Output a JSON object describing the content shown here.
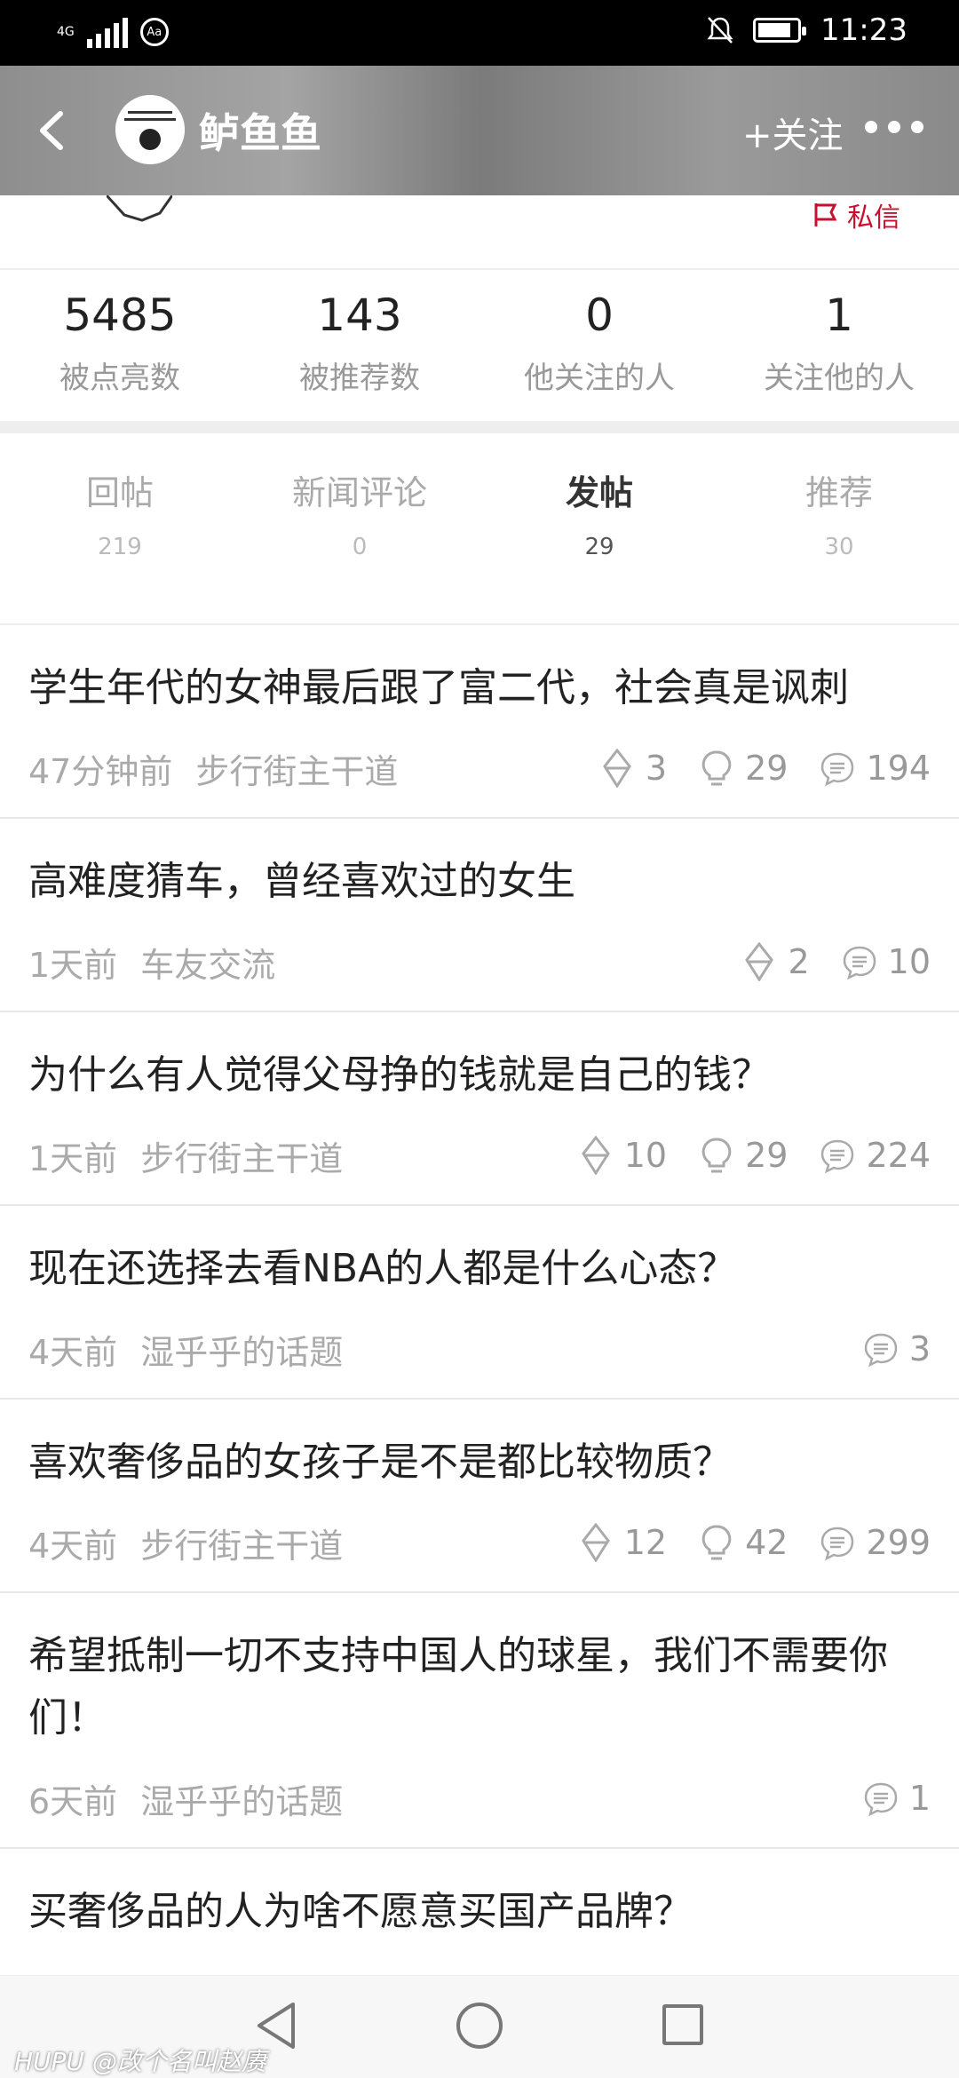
{
  "status_bar": {
    "network": "4G",
    "time": "11:23"
  },
  "header": {
    "username": "鲈鱼鱼",
    "follow_label": "+关注",
    "dm_label": "私信"
  },
  "stats": [
    {
      "value": "5485",
      "label": "被点亮数"
    },
    {
      "value": "143",
      "label": "被推荐数"
    },
    {
      "value": "0",
      "label": "他关注的人"
    },
    {
      "value": "1",
      "label": "关注他的人"
    }
  ],
  "tabs": [
    {
      "label": "回帖",
      "count": "219"
    },
    {
      "label": "新闻评论",
      "count": "0"
    },
    {
      "label": "发帖",
      "count": "29",
      "active": true
    },
    {
      "label": "推荐",
      "count": "30"
    }
  ],
  "posts": [
    {
      "title": "学生年代的女神最后跟了富二代，社会真是讽刺",
      "time": "47分钟前",
      "board": "步行街主干道",
      "lights": "3",
      "recommends": "29",
      "replies": "194"
    },
    {
      "title": "高难度猜车，曾经喜欢过的女生",
      "time": "1天前",
      "board": "车友交流",
      "lights": "2",
      "replies": "10"
    },
    {
      "title": "为什么有人觉得父母挣的钱就是自己的钱？",
      "time": "1天前",
      "board": "步行街主干道",
      "lights": "10",
      "recommends": "29",
      "replies": "224"
    },
    {
      "title": "现在还选择去看NBA的人都是什么心态？",
      "time": "4天前",
      "board": "湿乎乎的话题",
      "replies": "3"
    },
    {
      "title": "喜欢奢侈品的女孩子是不是都比较物质？",
      "time": "4天前",
      "board": "步行街主干道",
      "lights": "12",
      "recommends": "42",
      "replies": "299"
    },
    {
      "title": "希望抵制一切不支持中国人的球星，我们不需要你们！",
      "time": "6天前",
      "board": "湿乎乎的话题",
      "replies": "1"
    },
    {
      "title": "买奢侈品的人为啥不愿意买国产品牌？"
    }
  ],
  "watermark": "HUPU @改个名叫赵赓"
}
